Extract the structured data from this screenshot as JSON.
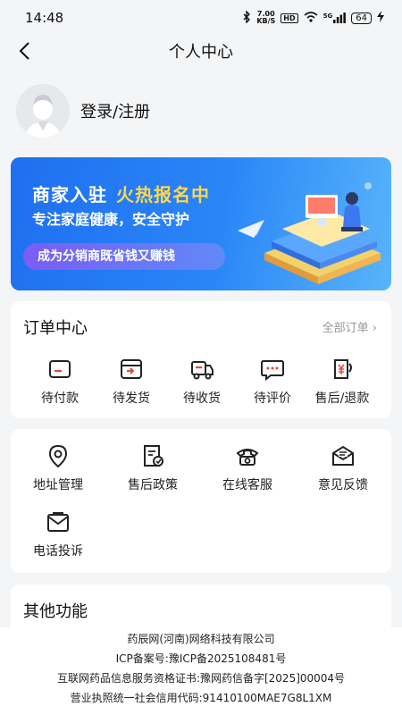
{
  "status_bar": {
    "time": "14:48",
    "net_speed": "7.00",
    "net_unit": "KB/S",
    "hd": "HD",
    "signal": "5G",
    "battery": "64"
  },
  "header": {
    "title": "个人中心"
  },
  "profile": {
    "login_label": "登录/注册"
  },
  "banner": {
    "title_a": "商家入驻",
    "title_b": "火热报名中",
    "subtitle": "专注家庭健康，安全守护",
    "pill": "成为分销商既省钱又赚钱"
  },
  "orders": {
    "title": "订单中心",
    "all_label": "全部订单 ›",
    "items": [
      {
        "label": "待付款",
        "icon": "card-payment-icon"
      },
      {
        "label": "待发货",
        "icon": "ship-box-icon"
      },
      {
        "label": "待收货",
        "icon": "delivery-truck-icon"
      },
      {
        "label": "待评价",
        "icon": "comment-icon"
      },
      {
        "label": "售后/退款",
        "icon": "refund-icon"
      }
    ]
  },
  "services": {
    "items": [
      {
        "label": "地址管理",
        "icon": "location-pin-icon"
      },
      {
        "label": "售后政策",
        "icon": "policy-doc-icon"
      },
      {
        "label": "在线客服",
        "icon": "phone-icon"
      },
      {
        "label": "意见反馈",
        "icon": "feedback-mail-icon"
      },
      {
        "label": "电话投诉",
        "icon": "complaint-mail-icon"
      }
    ]
  },
  "other": {
    "title": "其他功能"
  },
  "footer": {
    "company": "药辰网(河南)网络科技有限公司",
    "icp": "ICP备案号:豫ICP备2025108481号",
    "license": "互联网药品信息服务资格证书:豫网药信备字[2025]00004号",
    "credit": "营业执照统一社会信用代码:91410100MAE7G8L1XM"
  },
  "colors": {
    "accent": "#e8473a",
    "banner_blue": "#2a86f7",
    "banner_yellow": "#ffd84a",
    "background": "#f4f5f7"
  }
}
